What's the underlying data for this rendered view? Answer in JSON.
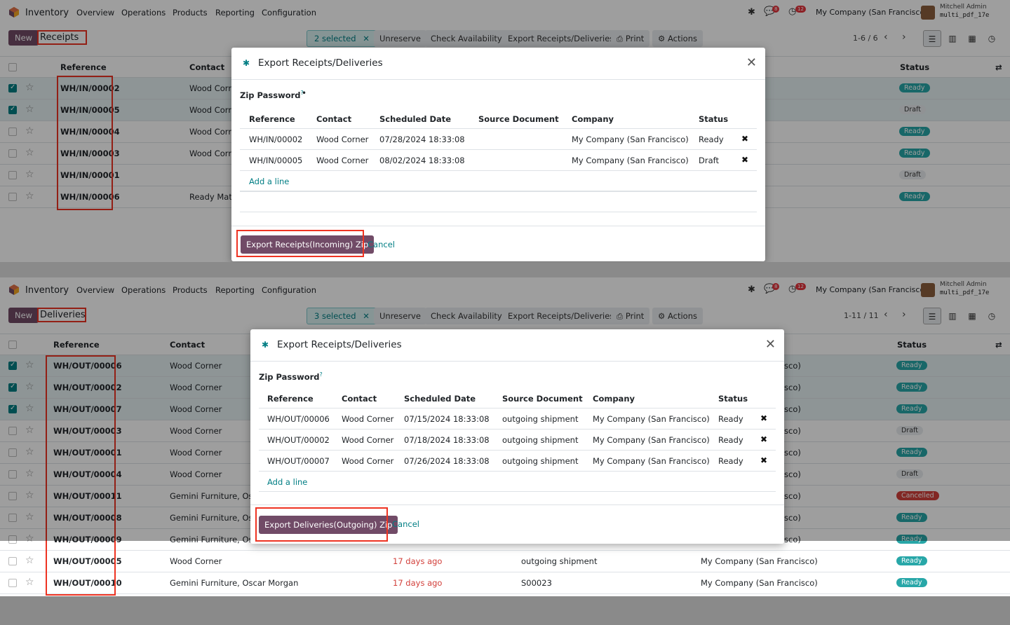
{
  "colors": {
    "brand": "#714b67",
    "accent": "#017e84",
    "ready": "#28a7a8",
    "cancelled": "#d23f3a",
    "highlight": "#e32"
  },
  "top": {
    "navbar": {
      "app_name": "Inventory",
      "menu": [
        "Overview",
        "Operations",
        "Products",
        "Reporting",
        "Configuration"
      ],
      "badges": [
        "8",
        "12"
      ],
      "company": "My Company (San Francisco)",
      "user": "Mitchell Admin",
      "db": "multi_pdf_17e"
    },
    "control": {
      "new_label": "New",
      "breadcrumb": "Receipts",
      "selected": "2 selected",
      "actions": [
        "Unreserve",
        "Check Availability",
        "Export Receipts/Deliveries",
        "Print",
        "Actions"
      ],
      "pager": "1-6 / 6"
    },
    "list": {
      "headers": {
        "reference": "Reference",
        "contact": "Contact",
        "status": "Status"
      },
      "rows": [
        {
          "ref": "WH/IN/00002",
          "contact": "Wood Corne",
          "status": "Ready",
          "selected": true
        },
        {
          "ref": "WH/IN/00005",
          "contact": "Wood Corne",
          "status": "Draft",
          "selected": true
        },
        {
          "ref": "WH/IN/00004",
          "contact": "Wood Corne",
          "status": "Ready",
          "selected": false
        },
        {
          "ref": "WH/IN/00003",
          "contact": "Wood Corne",
          "status": "Ready",
          "selected": false
        },
        {
          "ref": "WH/IN/00001",
          "contact": "",
          "status": "Draft",
          "selected": false
        },
        {
          "ref": "WH/IN/00006",
          "contact": "Ready Mat",
          "status": "Ready",
          "selected": false
        }
      ]
    },
    "dialog": {
      "title": "Export Receipts/Deliveries",
      "zip_label": "Zip Password",
      "zip_help": "?",
      "zip_value": "•",
      "headers": [
        "Reference",
        "Contact",
        "Scheduled Date",
        "Source Document",
        "Company",
        "Status"
      ],
      "rows": [
        {
          "ref": "WH/IN/00002",
          "contact": "Wood Corner",
          "date": "07/28/2024 18:33:08",
          "source": "",
          "company": "My Company (San Francisco)",
          "status": "Ready"
        },
        {
          "ref": "WH/IN/00005",
          "contact": "Wood Corner",
          "date": "08/02/2024 18:33:08",
          "source": "",
          "company": "My Company (San Francisco)",
          "status": "Draft"
        }
      ],
      "add_line": "Add a line",
      "primary": "Export Receipts(Incoming) Zip",
      "cancel": "Cancel"
    }
  },
  "bottom": {
    "navbar": {
      "app_name": "Inventory",
      "menu": [
        "Overview",
        "Operations",
        "Products",
        "Reporting",
        "Configuration"
      ],
      "badges": [
        "8",
        "12"
      ],
      "company": "My Company (San Francisco)",
      "user": "Mitchell Admin",
      "db": "multi_pdf_17e"
    },
    "control": {
      "new_label": "New",
      "breadcrumb": "Deliveries",
      "selected": "3 selected",
      "actions": [
        "Unreserve",
        "Check Availability",
        "Export Receipts/Deliveries",
        "Print",
        "Actions"
      ],
      "pager": "1-11 / 11"
    },
    "list": {
      "headers": {
        "reference": "Reference",
        "contact": "Contact",
        "status": "Status"
      },
      "rows": [
        {
          "ref": "WH/OUT/00006",
          "contact": "Wood Corner",
          "date": "",
          "source": "",
          "company": "sco)",
          "status": "Ready",
          "selected": true
        },
        {
          "ref": "WH/OUT/00002",
          "contact": "Wood Corner",
          "date": "",
          "source": "",
          "company": "sco)",
          "status": "Ready",
          "selected": true
        },
        {
          "ref": "WH/OUT/00007",
          "contact": "Wood Corner",
          "date": "",
          "source": "",
          "company": "sco)",
          "status": "Ready",
          "selected": true
        },
        {
          "ref": "WH/OUT/00003",
          "contact": "Wood Corner",
          "date": "",
          "source": "",
          "company": "sco)",
          "status": "Draft",
          "selected": false
        },
        {
          "ref": "WH/OUT/00001",
          "contact": "Wood Corner",
          "date": "",
          "source": "",
          "company": "sco)",
          "status": "Ready",
          "selected": false
        },
        {
          "ref": "WH/OUT/00004",
          "contact": "Wood Corner",
          "date": "",
          "source": "",
          "company": "sco)",
          "status": "Draft",
          "selected": false
        },
        {
          "ref": "WH/OUT/00011",
          "contact": "Gemini Furniture, Osca",
          "date": "",
          "source": "",
          "company": "sco)",
          "status": "Cancelled",
          "selected": false
        },
        {
          "ref": "WH/OUT/00008",
          "contact": "Gemini Furniture, Osca",
          "date": "",
          "source": "",
          "company": "sco)",
          "status": "Ready",
          "selected": false
        },
        {
          "ref": "WH/OUT/00009",
          "contact": "Gemini Furniture, Osca",
          "date": "",
          "source": "",
          "company": "sco)",
          "status": "Ready",
          "selected": false
        },
        {
          "ref": "WH/OUT/00005",
          "contact": "Wood Corner",
          "date": "17 days ago",
          "source": "outgoing shipment",
          "company": "My Company (San Francisco)",
          "status": "Ready",
          "selected": false
        },
        {
          "ref": "WH/OUT/00010",
          "contact": "Gemini Furniture, Oscar Morgan",
          "date": "17 days ago",
          "source": "S00023",
          "company": "My Company (San Francisco)",
          "status": "Ready",
          "selected": false
        }
      ]
    },
    "dialog": {
      "title": "Export Receipts/Deliveries",
      "zip_label": "Zip Password",
      "zip_help": "?",
      "zip_value": "",
      "headers": [
        "Reference",
        "Contact",
        "Scheduled Date",
        "Source Document",
        "Company",
        "Status"
      ],
      "rows": [
        {
          "ref": "WH/OUT/00006",
          "contact": "Wood Corner",
          "date": "07/15/2024 18:33:08",
          "source": "outgoing shipment",
          "company": "My Company (San Francisco)",
          "status": "Ready"
        },
        {
          "ref": "WH/OUT/00002",
          "contact": "Wood Corner",
          "date": "07/18/2024 18:33:08",
          "source": "outgoing shipment",
          "company": "My Company (San Francisco)",
          "status": "Ready"
        },
        {
          "ref": "WH/OUT/00007",
          "contact": "Wood Corner",
          "date": "07/26/2024 18:33:08",
          "source": "outgoing shipment",
          "company": "My Company (San Francisco)",
          "status": "Ready"
        }
      ],
      "add_line": "Add a line",
      "primary": "Export Deliveries(Outgoing) Zip",
      "cancel": "Cancel"
    }
  }
}
